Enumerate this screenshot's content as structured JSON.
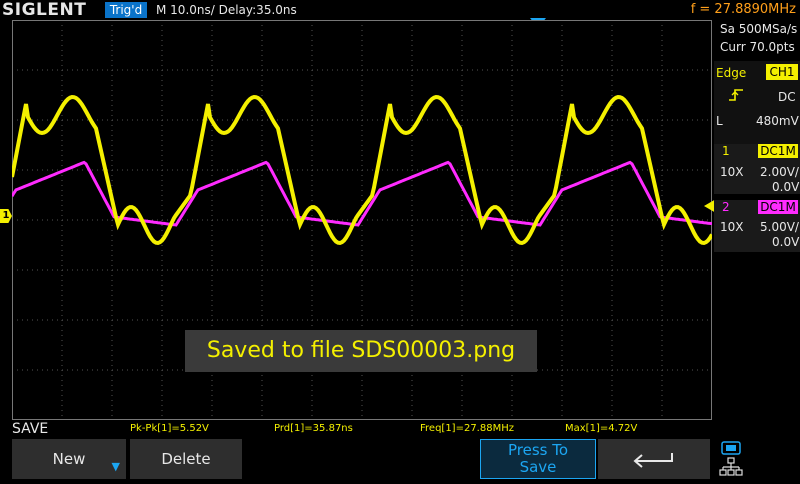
{
  "header": {
    "logo": "SIGLENT",
    "trigger_status": "Trig'd",
    "timebase": "M 10.0ns/  Delay:35.0ns",
    "frequency": "f = 27.8890MHz"
  },
  "right_panel": {
    "sample_rate": "Sa 500MSa/s",
    "curr_points": "Curr 70.0pts",
    "trigger": {
      "type_label": "Edge",
      "source": "CH1",
      "slope_icon": "rising-edge-icon",
      "coupling": "DC",
      "level_label": "L",
      "level": "480mV"
    },
    "ch1": {
      "number": "1",
      "coupling": "DC1M",
      "probe": "10X",
      "scale": "2.00V/",
      "offset": "0.0V"
    },
    "ch2": {
      "number": "2",
      "coupling": "DC1M",
      "probe": "10X",
      "scale": "5.00V/",
      "offset": "0.0V"
    }
  },
  "grid_markers": {
    "ch1": "1"
  },
  "toast": "Saved to file SDS00003.png",
  "status": {
    "menu_title": "SAVE",
    "measurements": [
      "Pk-Pk[1]=5.52V",
      "Prd[1]=35.87ns",
      "Freq[1]=27.88MHz",
      "Max[1]=4.72V"
    ]
  },
  "softkeys": {
    "new": "New",
    "delete": "Delete",
    "press_to_save_line1": "Press To",
    "press_to_save_line2": "Save"
  },
  "colors": {
    "ch1": "#f4f000",
    "ch2": "#ff2bff",
    "accent_blue": "#1ca6f2",
    "frequency": "#ff9f1a"
  }
}
